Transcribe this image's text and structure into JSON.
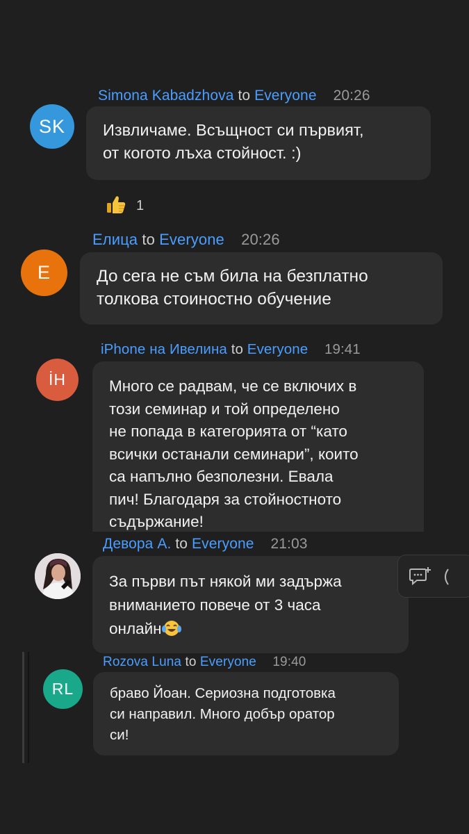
{
  "messages": [
    {
      "sender": "Simona Kabadzhova",
      "to_word": "to",
      "recipient": "Everyone",
      "time": "20:26",
      "avatar_initials": "SK",
      "avatar_color": "#3598dc",
      "lines": [
        "Извличаме. Всъщност си първият,",
        "от когото лъха стойност. :)"
      ],
      "reaction": {
        "emoji": "thumbs-up-emoji",
        "count": "1"
      }
    },
    {
      "sender": "Елица",
      "to_word": "to",
      "recipient": "Everyone",
      "time": "20:26",
      "avatar_initials": "E",
      "avatar_color": "#e8730c",
      "lines": [
        "До сега не съм била на безплатно",
        "толкова стоиностно обучение"
      ]
    },
    {
      "sender": "iPhone на Ивелина",
      "to_word": "to",
      "recipient": "Everyone",
      "time": "19:41",
      "avatar_initials": "İH",
      "avatar_color": "#d95c3f",
      "lines": [
        "Много се радвам, че се включих в",
        "този семинар и той определено",
        "не попада в категорията от “като",
        "всички останали семинари”, които",
        "са напълно безполезни. Евала",
        "пич! Благодаря за стойностното",
        "съдържание!"
      ]
    },
    {
      "sender": "Девора А.",
      "to_word": "to",
      "recipient": "Everyone",
      "time": "21:03",
      "avatar_type": "photo",
      "lines": [
        "За първи път някой ми задържа",
        "вниманието повече от 3 часа",
        "онлайн"
      ],
      "emoji": "tears-of-joy-emoji"
    },
    {
      "sender": "Rozova Luna",
      "to_word": "to",
      "recipient": "Everyone",
      "time": "19:40",
      "avatar_initials": "RL",
      "avatar_color": "#19a88a",
      "lines": [
        "браво Йоан. Сериозна подготовка",
        "си направил. Много добър оратор",
        "си!"
      ]
    }
  ],
  "hover_actions": [
    "reply-in-thread-icon",
    "more-icon"
  ]
}
